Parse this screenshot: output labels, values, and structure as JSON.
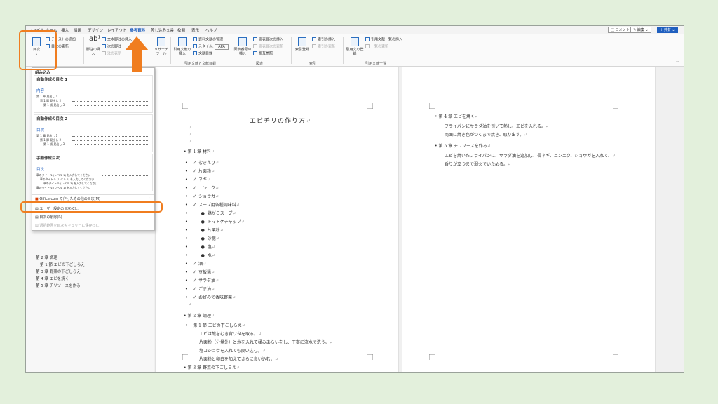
{
  "tabs": [
    "ファイル",
    "ホーム",
    "挿入",
    "描画",
    "デザイン",
    "レイアウト",
    "参考資料",
    "差し込み文書",
    "校閲",
    "表示",
    "ヘルプ"
  ],
  "active_tab": "参考資料",
  "top_right": {
    "comment": "コメント",
    "edit": "編集",
    "share": "共有"
  },
  "ribbon": {
    "toc_button": "目次",
    "add_text": "テキストの追加",
    "update_toc": "目次の更新",
    "footnote_button": "脚注の挿入",
    "insert_endnote": "文末脚注の挿入",
    "next_footnote": "次の脚注",
    "show_notes": "注の表示",
    "research_button": "リサーチ ツール",
    "citation_button": "引用文献の挿入",
    "manage_sources": "資料文献の管理",
    "style_label": "スタイル:",
    "style_value": "APA",
    "bibliography": "文献目録",
    "caption_button": "図表番号の挿入",
    "insert_table_of_figures": "図表目次の挿入",
    "update_table": "図表目次の更新",
    "cross_reference": "相互参照",
    "mark_entry_button": "索引登録",
    "insert_index": "索引の挿入",
    "update_index": "索引の更新",
    "mark_citation_button": "引用文の登録",
    "insert_table_of_authorities": "引用文献一覧の挿入",
    "update_table_auth": "一覧の更新",
    "group_citations": "引用文献と文献目録",
    "group_captions": "図表",
    "group_index": "索引",
    "group_authorities": "引用文献一覧"
  },
  "dropdown": {
    "builtin": "組み込み",
    "auto1": "自動作成の目次 1",
    "auto1_head": "内容",
    "auto2": "自動作成の目次 2",
    "auto2_head": "目次",
    "manual": "手動作成目次",
    "manual_head": "目次",
    "toc_rows": [
      "第 1 章  見出し 1",
      "第 1 節  見出し 2",
      "第 1 項  見出し 3"
    ],
    "manual_rows": [
      "章のタイトル (レベル 1) を入力してください",
      "章のタイトル (レベル 2) を入力してください",
      "章のタイトル (レベル 3) を入力してください",
      "章のタイトル (レベル 1) を入力してください"
    ],
    "office_more": "Office.com で作ったその他の目次(M)",
    "custom_toc": "ユーザー設定の目次(C)...",
    "remove_toc": "目次の削除(R)",
    "save_selection": "選択範囲を目次ギャラリーに保存(S)..."
  },
  "nav": [
    "第 1 節 エビの下ごしらえ",
    "第 3 章 野菜の下ごしらえ",
    "第 4 章 エビを焼く",
    "第 5 章 チリソースを作る"
  ],
  "nav_top": "第 2 章 調理",
  "page1": {
    "title": "エビチリの作り方",
    "ch1": "第 1 章  材料",
    "ingredients": [
      "むきえび",
      "片栗粉",
      "ネギ",
      "ニンニク",
      "ショウガ"
    ],
    "soup_item": "スープ用各種調味料",
    "seasonings": [
      "鶏がらスープ",
      "トマトケチャップ",
      "片栗粉",
      "砂糖",
      "塩",
      "水"
    ],
    "more_items": [
      "酒",
      "豆板醤",
      "サラダ油",
      "ごま油",
      "お好みで香味野菜"
    ],
    "ch2": "第 2 章  調理",
    "sec1": "第 1 節      エビの下ごしらえ",
    "ch2_lines": [
      "エビは殻をむき背ワタを取る。",
      "片栗粉（分量外）と水を入れて揉みあらいをし、丁寧に流水で洗う。",
      "塩コショウを入れても良い込む。",
      "片栗粉と卵白を加えてさらに良い込む。"
    ],
    "ch3": "第 3 章  野菜の下ごしらえ",
    "ch3_line": "長ネギ、ニンニクとショウガをみじん切りにする。"
  },
  "page2": {
    "ch4": "第 4 章  エビを焼く",
    "ch4_lines": [
      "フライパンにサラダ油を引いて熱し、エビを入れる。",
      "両面に焼き色がつくまで焼き、取り出す。"
    ],
    "ch5": "第 5 章  チリソースを作る",
    "ch5_lines": [
      "エビを焼いたフライパンに、サラダ油を追加し、長ネギ、ニンニク、ショウガを入れて、",
      "香りが立つまで弱火でいためる。"
    ]
  },
  "marks": {
    "para": "↵",
    "check": "✓",
    "bullet": "●",
    "dot": "•"
  },
  "colors": {
    "highlight": "#f07d1f",
    "accent": "#185abd",
    "background": "#e3f0dc"
  }
}
